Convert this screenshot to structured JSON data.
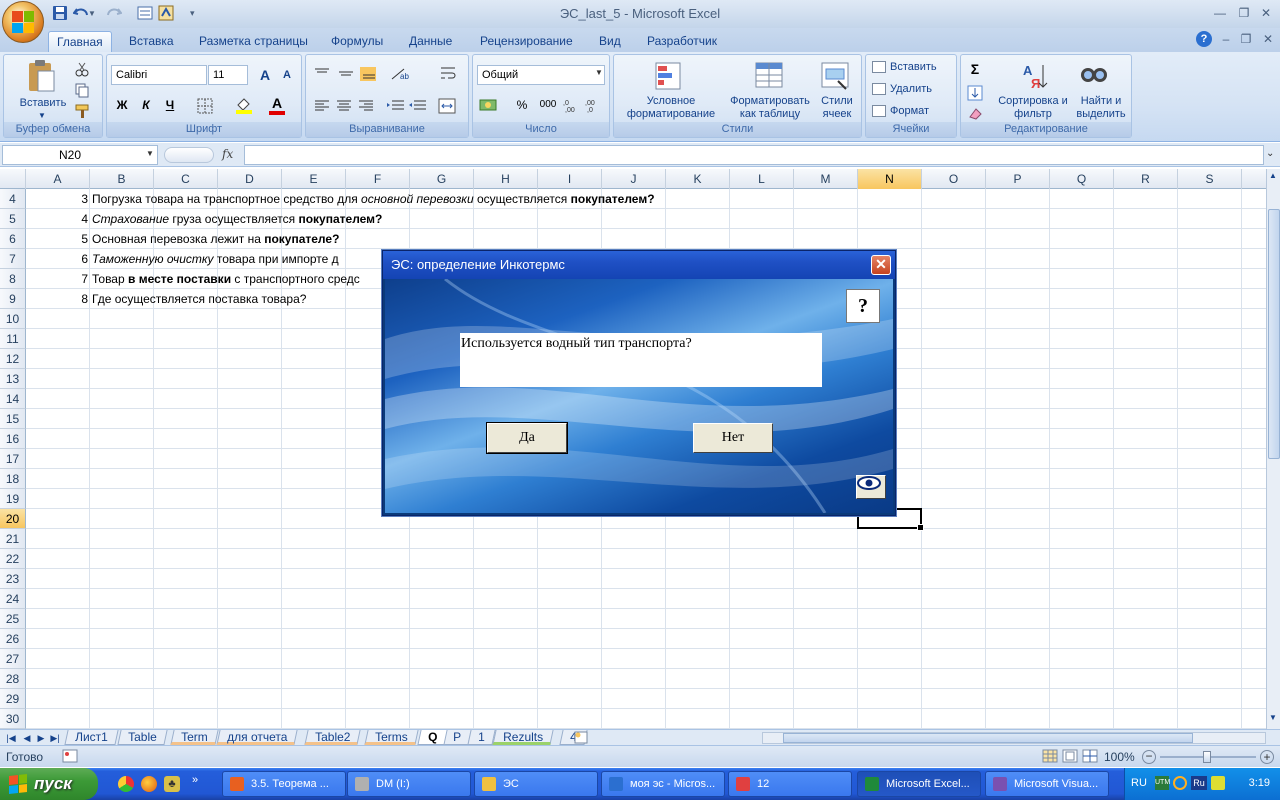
{
  "window": {
    "title": "ЭС_last_5 - Microsoft Excel"
  },
  "ribbon_tabs": [
    "Главная",
    "Вставка",
    "Разметка страницы",
    "Формулы",
    "Данные",
    "Рецензирование",
    "Вид",
    "Разработчик"
  ],
  "ribbon": {
    "clipboard": {
      "paste_label": "Вставить",
      "group_label": "Буфер обмена"
    },
    "font": {
      "font_name": "Calibri",
      "font_size": "11",
      "bold": "Ж",
      "italic": "К",
      "underline": "Ч",
      "grow": "A",
      "shrink": "A",
      "color": "A",
      "group_label": "Шрифт"
    },
    "alignment": {
      "group_label": "Выравнивание"
    },
    "number": {
      "format": "Общий",
      "percent": "%",
      "thousands": "000",
      "group_label": "Число"
    },
    "styles": {
      "conditional": "Условное форматирование",
      "as_table": "Форматировать как таблицу",
      "cell_styles": "Стили ячеек",
      "group_label": "Стили"
    },
    "cells": {
      "insert": "Вставить",
      "delete": "Удалить",
      "format": "Формат",
      "group_label": "Ячейки"
    },
    "editing": {
      "sum": "Σ",
      "sort": "Сортировка и фильтр",
      "find": "Найти и выделить",
      "group_label": "Редактирование"
    }
  },
  "formula_bar": {
    "name_box": "N20",
    "fx": "fx",
    "value": ""
  },
  "columns": [
    "A",
    "B",
    "C",
    "D",
    "E",
    "F",
    "G",
    "H",
    "I",
    "J",
    "K",
    "L",
    "M",
    "N",
    "O",
    "P",
    "Q",
    "R",
    "S"
  ],
  "selected_column": "N",
  "rows": [
    "4",
    "5",
    "6",
    "7",
    "8",
    "9",
    "10",
    "11",
    "12",
    "13",
    "14",
    "15",
    "16",
    "17",
    "18",
    "19",
    "20",
    "21",
    "22",
    "23",
    "24",
    "25",
    "26",
    "27",
    "28",
    "29",
    "30"
  ],
  "selected_row": "20",
  "cells": [
    {
      "a": "3",
      "b": [
        {
          "t": "Погрузка товара на транспортное средство для "
        },
        {
          "t": "основной перевозки",
          "i": true
        },
        {
          "t": "  осуществляется "
        },
        {
          "t": "покупателем?",
          "b": true
        }
      ]
    },
    {
      "a": "4",
      "b": [
        {
          "t": "Страхование",
          "i": true
        },
        {
          "t": "  груза осуществляется "
        },
        {
          "t": "покупателем?",
          "b": true
        }
      ]
    },
    {
      "a": "5",
      "b": [
        {
          "t": "Основная перевозка лежит на "
        },
        {
          "t": "покупателе?",
          "b": true
        }
      ]
    },
    {
      "a": "6",
      "b": [
        {
          "t": "Таможенную очистку",
          "i": true
        },
        {
          "t": "  товара при импорте д"
        }
      ]
    },
    {
      "a": "7",
      "b": [
        {
          "t": "Товар "
        },
        {
          "t": "в месте поставки",
          "b": true
        },
        {
          "t": " с транспортного средс"
        }
      ]
    },
    {
      "a": "8",
      "b": [
        {
          "t": "Где осуществляется поставка товара?"
        }
      ]
    }
  ],
  "sheet_tabs": [
    {
      "name": "Лист1",
      "color": ""
    },
    {
      "name": "Table",
      "color": ""
    },
    {
      "name": "Term",
      "color": "#f4c28a"
    },
    {
      "name": "для отчета",
      "color": "#f4c28a"
    },
    {
      "name": "Table2",
      "color": "#f4c28a"
    },
    {
      "name": "Terms",
      "color": "#f4c28a"
    },
    {
      "name": "Q",
      "color": "",
      "active": true
    },
    {
      "name": "P",
      "color": ""
    },
    {
      "name": "1",
      "color": ""
    },
    {
      "name": "Rezults",
      "color": "#9bd26a"
    },
    {
      "name": "4",
      "color": ""
    }
  ],
  "status": {
    "ready": "Готово",
    "zoom": "100%"
  },
  "dialog": {
    "title": "ЭС: определение Инкотермс",
    "question": "Используется водный тип транспорта?",
    "yes": "Да",
    "no": "Нет",
    "help": "?",
    "close": "✕"
  },
  "taskbar": {
    "start": "пуск",
    "tasks": [
      {
        "label": "3.5. Теорема ...",
        "active": false
      },
      {
        "label": "DM (I:)",
        "active": false
      },
      {
        "label": "ЭС",
        "active": false
      },
      {
        "label": "моя эс - Micros...",
        "active": false
      },
      {
        "label": "12",
        "active": false
      },
      {
        "label": "Microsoft Excel...",
        "active": true
      },
      {
        "label": "Microsoft Visua...",
        "active": false
      }
    ],
    "lang": "RU",
    "clock": "3:19"
  }
}
